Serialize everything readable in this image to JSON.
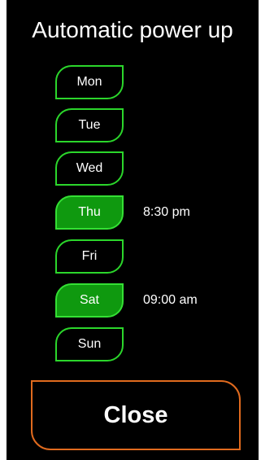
{
  "title": "Automatic power up",
  "days": [
    {
      "label": "Mon",
      "active": false,
      "time": ""
    },
    {
      "label": "Tue",
      "active": false,
      "time": ""
    },
    {
      "label": "Wed",
      "active": false,
      "time": ""
    },
    {
      "label": "Thu",
      "active": true,
      "time": "8:30 pm"
    },
    {
      "label": "Fri",
      "active": false,
      "time": ""
    },
    {
      "label": "Sat",
      "active": true,
      "time": "09:00 am"
    },
    {
      "label": "Sun",
      "active": false,
      "time": ""
    }
  ],
  "close_label": "Close",
  "colors": {
    "background": "#000000",
    "day_border": "#2bd62b",
    "day_active_fill": "#0f990f",
    "close_border": "#e06a1e",
    "text": "#ffffff"
  }
}
